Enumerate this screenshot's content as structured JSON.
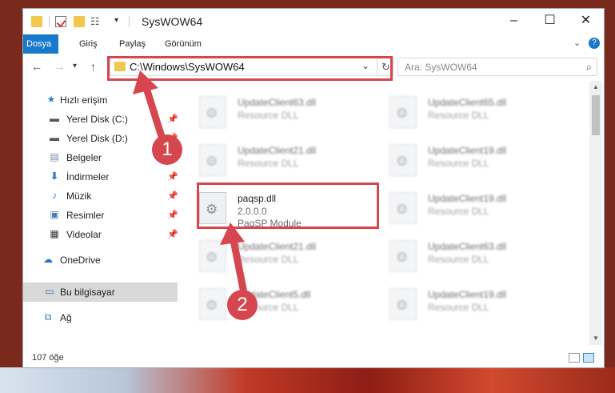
{
  "window": {
    "title": "SysWOW64"
  },
  "ribbon": {
    "tabs": [
      {
        "label": "Dosya",
        "active": true
      },
      {
        "label": "Giriş",
        "active": false
      },
      {
        "label": "Paylaş",
        "active": false
      },
      {
        "label": "Görünüm",
        "active": false
      }
    ],
    "expand_icon": "chevron-down-icon",
    "help_label": "?"
  },
  "address_bar": {
    "path": "C:\\Windows\\SysWOW64"
  },
  "search": {
    "placeholder": "Ara: SysWOW64"
  },
  "sidebar": {
    "items": [
      {
        "label": "Hızlı erişim",
        "icon": "star-icon"
      },
      {
        "label": "Yerel Disk (C:)",
        "icon": "drive-icon",
        "pinned": true
      },
      {
        "label": "Yerel Disk (D:)",
        "icon": "drive-icon",
        "pinned": true
      },
      {
        "label": "Belgeler",
        "icon": "documents-icon",
        "pinned": true
      },
      {
        "label": "İndirmeler",
        "icon": "download-icon",
        "pinned": true
      },
      {
        "label": "Müzik",
        "icon": "music-icon",
        "pinned": true
      },
      {
        "label": "Resimler",
        "icon": "pictures-icon",
        "pinned": true
      },
      {
        "label": "Videolar",
        "icon": "video-icon",
        "pinned": true
      },
      {
        "label": "OneDrive",
        "icon": "cloud-icon"
      },
      {
        "label": "Bu bilgisayar",
        "icon": "computer-icon",
        "selected": true
      },
      {
        "label": "Ağ",
        "icon": "network-icon"
      }
    ]
  },
  "files": [
    {
      "name": "UpdateClient63.dll",
      "type": "Resource DLL"
    },
    {
      "name": "UpdateClient65.dll",
      "type": "Resource DLL"
    },
    {
      "name": "UpdateClient21.dll",
      "type": "Resource DLL"
    },
    {
      "name": "UpdateClient19.dll",
      "type": "Resource DLL"
    },
    {
      "name": "paqsp.dll",
      "version": "2.0.0.0",
      "type": "PaqSP Module",
      "highlighted": true
    },
    {
      "name": "UpdateClient19.dll",
      "type": "Resource DLL"
    },
    {
      "name": "UpdateClient21.dll",
      "type": "Resource DLL"
    },
    {
      "name": "UpdateClient63.dll",
      "type": "Resource DLL"
    },
    {
      "name": "UpdateClient5.dll",
      "type": "Resource DLL"
    },
    {
      "name": "UpdateClient19.dll",
      "type": "Resource DLL"
    }
  ],
  "status": {
    "item_count": "107 öğe"
  },
  "annotations": {
    "step1": "1",
    "step2": "2",
    "color": "#d6464f"
  }
}
